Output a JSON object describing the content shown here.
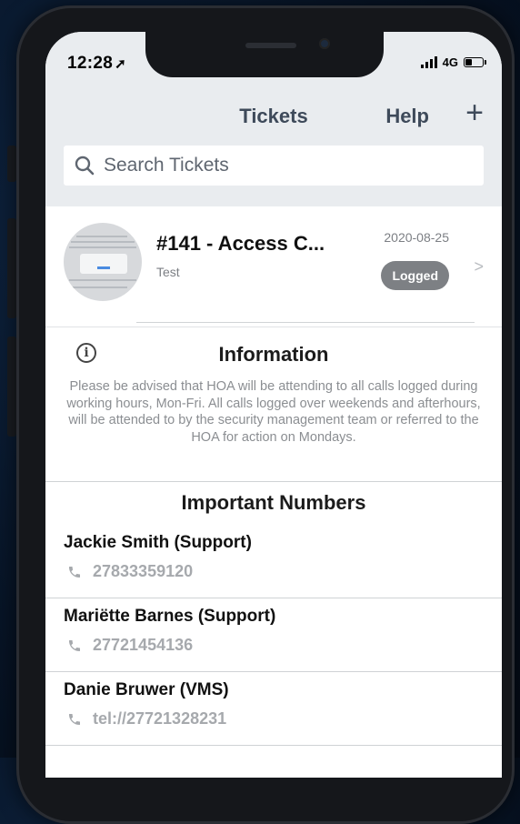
{
  "status_bar": {
    "time": "12:28",
    "network": "4G"
  },
  "nav": {
    "title": "Tickets",
    "help": "Help",
    "add": "+"
  },
  "search": {
    "placeholder": "Search Tickets"
  },
  "ticket": {
    "title": "#141 - Access C...",
    "subtitle": "Test",
    "date": "2020-08-25",
    "status": "Logged"
  },
  "info": {
    "title": "Information",
    "body": "Please be advised that HOA will be attending to all calls logged during working hours, Mon-Fri. All calls  logged over weekends and afterhours, will be attended to by the security management team or referred to the HOA for action on Mondays."
  },
  "numbers": {
    "title": "Important Numbers",
    "contacts": [
      {
        "name": "Jackie Smith (Support)",
        "number": "27833359120"
      },
      {
        "name": "Mariëtte Barnes (Support)",
        "number": "27721454136"
      },
      {
        "name": "Danie Bruwer (VMS)",
        "number": "tel://27721328231"
      }
    ]
  },
  "colors": {
    "nav_text": "#3e4a5a",
    "header_bg": "#e9ecef",
    "badge_bg": "#7d8084",
    "muted_text": "#8b8e92"
  }
}
